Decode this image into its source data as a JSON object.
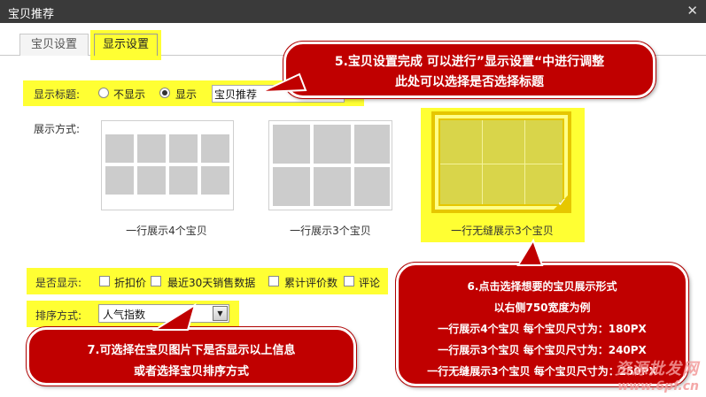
{
  "window": {
    "title": "宝贝推荐",
    "close_glyph": "✕"
  },
  "tabs": [
    {
      "label": "宝贝设置"
    },
    {
      "label": "显示设置"
    }
  ],
  "display_title": {
    "label": "显示标题:",
    "options": [
      "不显示",
      "显示"
    ],
    "selected": "显示",
    "input_value": "宝贝推荐"
  },
  "display_mode": {
    "label": "展示方式:",
    "cards": [
      {
        "label": "一行展示4个宝贝"
      },
      {
        "label": "一行展示3个宝贝"
      },
      {
        "label": "一行无缝展示3个宝贝",
        "selected": true
      }
    ]
  },
  "show_flags": {
    "label": "是否显示:",
    "options": [
      "折扣价",
      "最近30天销售数据",
      "累计评价数",
      "评论"
    ]
  },
  "sort": {
    "label": "排序方式:",
    "value": "人气指数"
  },
  "callouts": {
    "c5": [
      "5.宝贝设置完成 可以进行”显示设置“中进行调整",
      "此处可以选择是否选择标题"
    ],
    "c6": [
      "6.点击选择想要的宝贝展示形式",
      "以右侧750宽度为例",
      "一行展示4个宝贝 每个宝贝尺寸为：180PX",
      "一行展示3个宝贝 每个宝贝尺寸为：240PX",
      "一行无缝展示3个宝贝 每个宝贝尺寸为：250PX"
    ],
    "c7": [
      "7.可选择在宝贝图片下是否显示以上信息",
      "或者选择宝贝排序方式"
    ]
  },
  "watermark": {
    "line1": "资源批发网",
    "line2": "www.6pf.cn"
  },
  "colors": {
    "highlight": "#ffff33",
    "callout": "#c00000",
    "titlebar": "#3a3a3a"
  }
}
